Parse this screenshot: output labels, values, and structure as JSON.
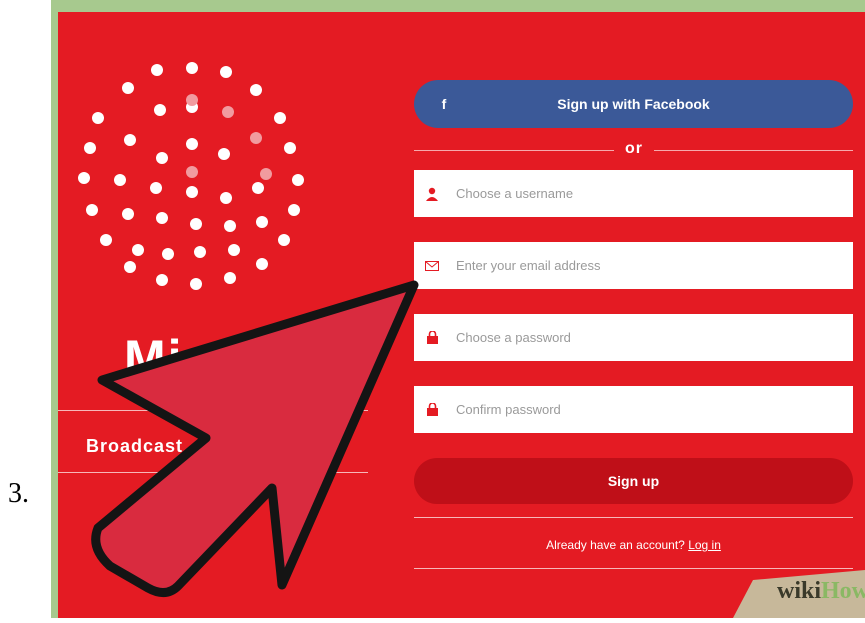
{
  "step_number": "3.",
  "left_panel": {
    "brand_text": "Mi",
    "tagline": "Broadcast"
  },
  "signup_form": {
    "facebook_icon": "f",
    "facebook_label": "Sign up with Facebook",
    "divider_text": "or",
    "username_placeholder": "Choose a username",
    "email_placeholder": "Enter your email address",
    "password_placeholder": "Choose a password",
    "confirm_placeholder": "Confirm password",
    "signup_label": "Sign up",
    "login_prompt": "Already have an account?",
    "login_link": "Log in"
  },
  "watermark": {
    "wiki": "wiki",
    "how": "How"
  },
  "colors": {
    "background_red": "#e41b23",
    "facebook_blue": "#3b5998",
    "signup_dark_red": "#bf0f18",
    "arrow_fill": "#d92b3f",
    "frame_green": "#a7c98e"
  },
  "icons": [
    "user-icon",
    "mail-icon",
    "lock-icon",
    "lock-icon",
    "pointer-arrow-icon",
    "logo-dots-icon"
  ]
}
